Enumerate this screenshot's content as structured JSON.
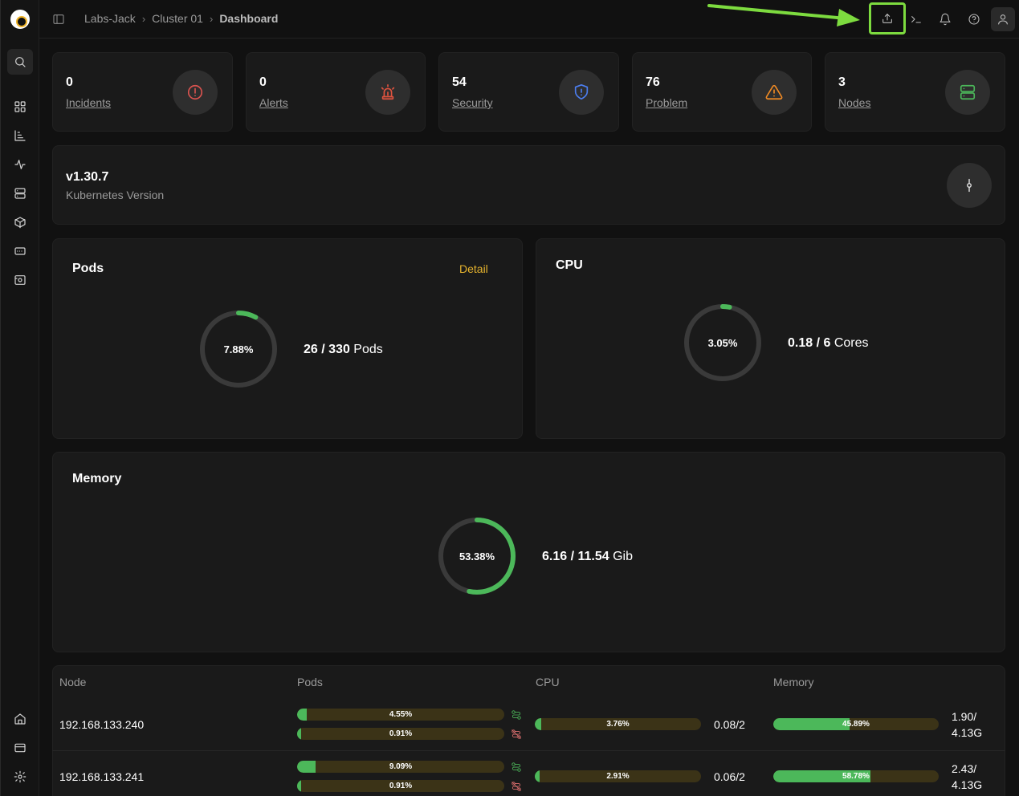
{
  "breadcrumb": {
    "root": "Labs-Jack",
    "cluster": "Cluster 01",
    "current": "Dashboard"
  },
  "header_icons": [
    "upload-icon",
    "terminal-icon",
    "bell-icon",
    "help-icon",
    "user-icon"
  ],
  "sidebar_icons": [
    "search-icon",
    "grid-icon",
    "chart-icon",
    "activity-icon",
    "server-icon",
    "box-icon",
    "card-icon",
    "device-icon",
    "home-icon",
    "billing-icon",
    "settings-icon"
  ],
  "stats": [
    {
      "value": "0",
      "label": "Incidents",
      "icon": "alert-circle-icon",
      "color": "#d9534f"
    },
    {
      "value": "0",
      "label": "Alerts",
      "icon": "siren-icon",
      "color": "#e0533f"
    },
    {
      "value": "54",
      "label": "Security",
      "icon": "shield-icon",
      "color": "#4c7ef0"
    },
    {
      "value": "76",
      "label": "Problem",
      "icon": "warning-icon",
      "color": "#f08a24"
    },
    {
      "value": "3",
      "label": "Nodes",
      "icon": "server-icon",
      "color": "#4cb85a"
    }
  ],
  "version": {
    "value": "v1.30.7",
    "label": "Kubernetes Version"
  },
  "pods": {
    "title": "Pods",
    "detail": "Detail",
    "percent_label": "7.88%",
    "percent": 7.88,
    "used": "26",
    "sep": " / ",
    "total": "330",
    "unit": " Pods"
  },
  "cpu": {
    "title": "CPU",
    "percent_label": "3.05%",
    "percent": 3.05,
    "used": "0.18",
    "sep": " / ",
    "total": "6",
    "unit": " Cores"
  },
  "memory": {
    "title": "Memory",
    "percent_label": "53.38%",
    "percent": 53.38,
    "used": "6.16",
    "sep": " / ",
    "total": "11.54",
    "unit": " Gib"
  },
  "colors": {
    "accent_green": "#4cb85a",
    "track": "#3a3a3a",
    "bar_track": "#3b3317",
    "detail": "#e5b32e"
  },
  "nodes_table": {
    "headers": {
      "node": "Node",
      "pods": "Pods",
      "cpu": "CPU",
      "memory": "Memory"
    },
    "rows": [
      {
        "ip": "192.168.133.240",
        "pods_running": "4.55%",
        "pods_running_value": 4.55,
        "pods_failed": "0.91%",
        "pods_failed_value": 0.91,
        "cpu": "3.76%",
        "cpu_value": 3.76,
        "cpu_cores": "0.08/2",
        "memory": "45.89%",
        "memory_value": 45.89,
        "memory_used": "1.90/",
        "memory_total": "4.13G"
      },
      {
        "ip": "192.168.133.241",
        "pods_running": "9.09%",
        "pods_running_value": 9.09,
        "pods_failed": "0.91%",
        "pods_failed_value": 0.91,
        "cpu": "2.91%",
        "cpu_value": 2.91,
        "cpu_cores": "0.06/2",
        "memory": "58.78%",
        "memory_value": 58.78,
        "memory_used": "2.43/",
        "memory_total": "4.13G"
      }
    ]
  }
}
